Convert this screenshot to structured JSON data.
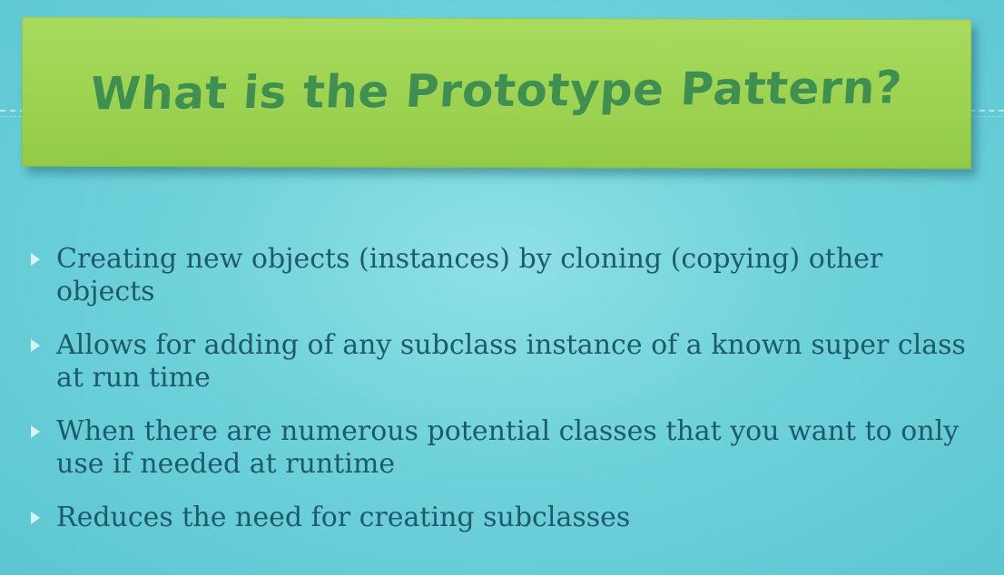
{
  "slide": {
    "title": "What is the Prototype Pattern?",
    "bullets": [
      "Creating new objects (instances) by cloning (copying) other objects",
      "Allows for adding of any subclass instance of a known super class at run time",
      "When there are numerous potential classes that you want to only use if needed at runtime",
      "Reduces the need for creating subclasses"
    ]
  },
  "colors": {
    "background": "#6fd2db",
    "banner": "#9cd24f",
    "title_text": "#3f8f50",
    "body_text": "#1f5a6a",
    "bullet_marker": "#ffffff"
  },
  "icons": {
    "bullet": "triangle-right-icon"
  }
}
